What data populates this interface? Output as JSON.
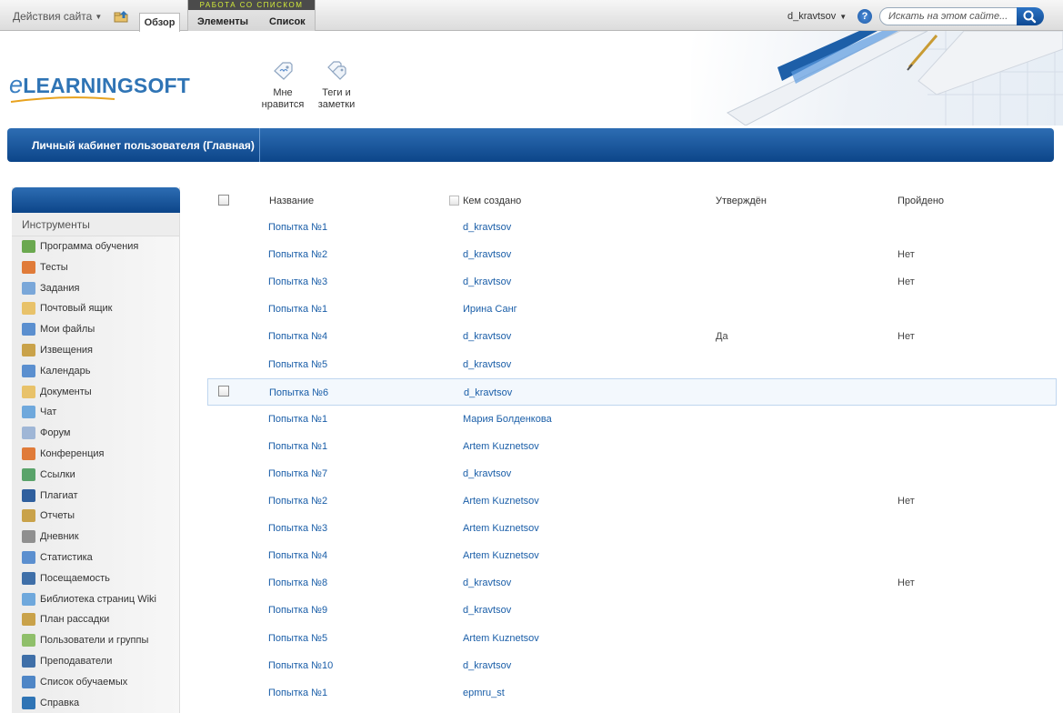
{
  "topbar": {
    "site_actions": "Действия сайта",
    "tab_overview": "Обзор",
    "context_group_label": "РАБОТА СО СПИСКОМ",
    "tab_elements": "Элементы",
    "tab_list": "Список",
    "user": "d_kravtsov",
    "help": "?",
    "search_placeholder": "Искать на этом сайте..."
  },
  "logo": {
    "e": "e",
    "rest": "LEARNINGSOFT"
  },
  "ribbon": {
    "like_line1": "Мне",
    "like_line2": "нравится",
    "tags_line1": "Теги и",
    "tags_line2": "заметки"
  },
  "page_title": "Личный кабинет пользователя (Главная)",
  "sidebar": {
    "section": "Инструменты",
    "items": [
      {
        "label": "Программа обучения",
        "icon": "tree-icon",
        "color": "#6aa84f"
      },
      {
        "label": "Тесты",
        "icon": "test-icon",
        "color": "#e07b39"
      },
      {
        "label": "Задания",
        "icon": "tasks-icon",
        "color": "#7aa7d9"
      },
      {
        "label": "Почтовый ящик",
        "icon": "mailbox-icon",
        "color": "#e8c26a"
      },
      {
        "label": "Мои файлы",
        "icon": "files-icon",
        "color": "#5b8fcf"
      },
      {
        "label": "Извещения",
        "icon": "megaphone-icon",
        "color": "#c9a24a"
      },
      {
        "label": "Календарь",
        "icon": "calendar-icon",
        "color": "#5b8fcf"
      },
      {
        "label": "Документы",
        "icon": "folder-icon",
        "color": "#e8c26a"
      },
      {
        "label": "Чат",
        "icon": "chat-icon",
        "color": "#6fa8dc"
      },
      {
        "label": "Форум",
        "icon": "forum-icon",
        "color": "#9fb6d6"
      },
      {
        "label": "Конференция",
        "icon": "conference-icon",
        "color": "#e07b39"
      },
      {
        "label": "Ссылки",
        "icon": "links-icon",
        "color": "#5aa36a"
      },
      {
        "label": "Плагиат",
        "icon": "plagiarism-icon",
        "color": "#2f5f9e"
      },
      {
        "label": "Отчеты",
        "icon": "reports-icon",
        "color": "#c9a24a"
      },
      {
        "label": "Дневник",
        "icon": "diary-icon",
        "color": "#8f8f8f"
      },
      {
        "label": "Статистика",
        "icon": "statistics-icon",
        "color": "#5b8fcf"
      },
      {
        "label": "Посещаемость",
        "icon": "attendance-icon",
        "color": "#3f6fa8"
      },
      {
        "label": "Библиотека страниц Wiki",
        "icon": "wiki-icon",
        "color": "#6fa8dc"
      },
      {
        "label": "План рассадки",
        "icon": "seating-icon",
        "color": "#c9a24a"
      },
      {
        "label": "Пользователи и группы",
        "icon": "users-icon",
        "color": "#8fbf6a"
      },
      {
        "label": "Преподаватели",
        "icon": "teachers-icon",
        "color": "#3f6fa8"
      },
      {
        "label": "Список обучаемых",
        "icon": "students-icon",
        "color": "#4f86c6"
      },
      {
        "label": "Справка",
        "icon": "help-icon",
        "color": "#2f74b5"
      }
    ]
  },
  "list": {
    "columns": {
      "name": "Название",
      "author": "Кем создано",
      "approved": "Утверждён",
      "passed": "Пройдено"
    },
    "rows": [
      {
        "name": "Попытка №1",
        "author": "d_kravtsov",
        "approved": "",
        "passed": ""
      },
      {
        "name": "Попытка №2",
        "author": "d_kravtsov",
        "approved": "",
        "passed": "Нет"
      },
      {
        "name": "Попытка №3",
        "author": "d_kravtsov",
        "approved": "",
        "passed": "Нет"
      },
      {
        "name": "Попытка №1",
        "author": "Ирина Санг",
        "approved": "",
        "passed": ""
      },
      {
        "name": "Попытка №4",
        "author": "d_kravtsov",
        "approved": "Да",
        "passed": "Нет"
      },
      {
        "name": "Попытка №5",
        "author": "d_kravtsov",
        "approved": "",
        "passed": ""
      },
      {
        "name": "Попытка №6",
        "author": "d_kravtsov",
        "approved": "",
        "passed": "",
        "selected": true
      },
      {
        "name": "Попытка №1",
        "author": "Мария Болденкова",
        "approved": "",
        "passed": ""
      },
      {
        "name": "Попытка №1",
        "author": "Artem Kuznetsov",
        "approved": "",
        "passed": ""
      },
      {
        "name": "Попытка №7",
        "author": "d_kravtsov",
        "approved": "",
        "passed": ""
      },
      {
        "name": "Попытка №2",
        "author": "Artem Kuznetsov",
        "approved": "",
        "passed": "Нет"
      },
      {
        "name": "Попытка №3",
        "author": "Artem Kuznetsov",
        "approved": "",
        "passed": ""
      },
      {
        "name": "Попытка №4",
        "author": "Artem Kuznetsov",
        "approved": "",
        "passed": ""
      },
      {
        "name": "Попытка №8",
        "author": "d_kravtsov",
        "approved": "",
        "passed": "Нет"
      },
      {
        "name": "Попытка №9",
        "author": "d_kravtsov",
        "approved": "",
        "passed": ""
      },
      {
        "name": "Попытка №5",
        "author": "Artem Kuznetsov",
        "approved": "",
        "passed": ""
      },
      {
        "name": "Попытка №10",
        "author": "d_kravtsov",
        "approved": "",
        "passed": ""
      },
      {
        "name": "Попытка №1",
        "author": "epmru_st",
        "approved": "",
        "passed": ""
      }
    ]
  }
}
